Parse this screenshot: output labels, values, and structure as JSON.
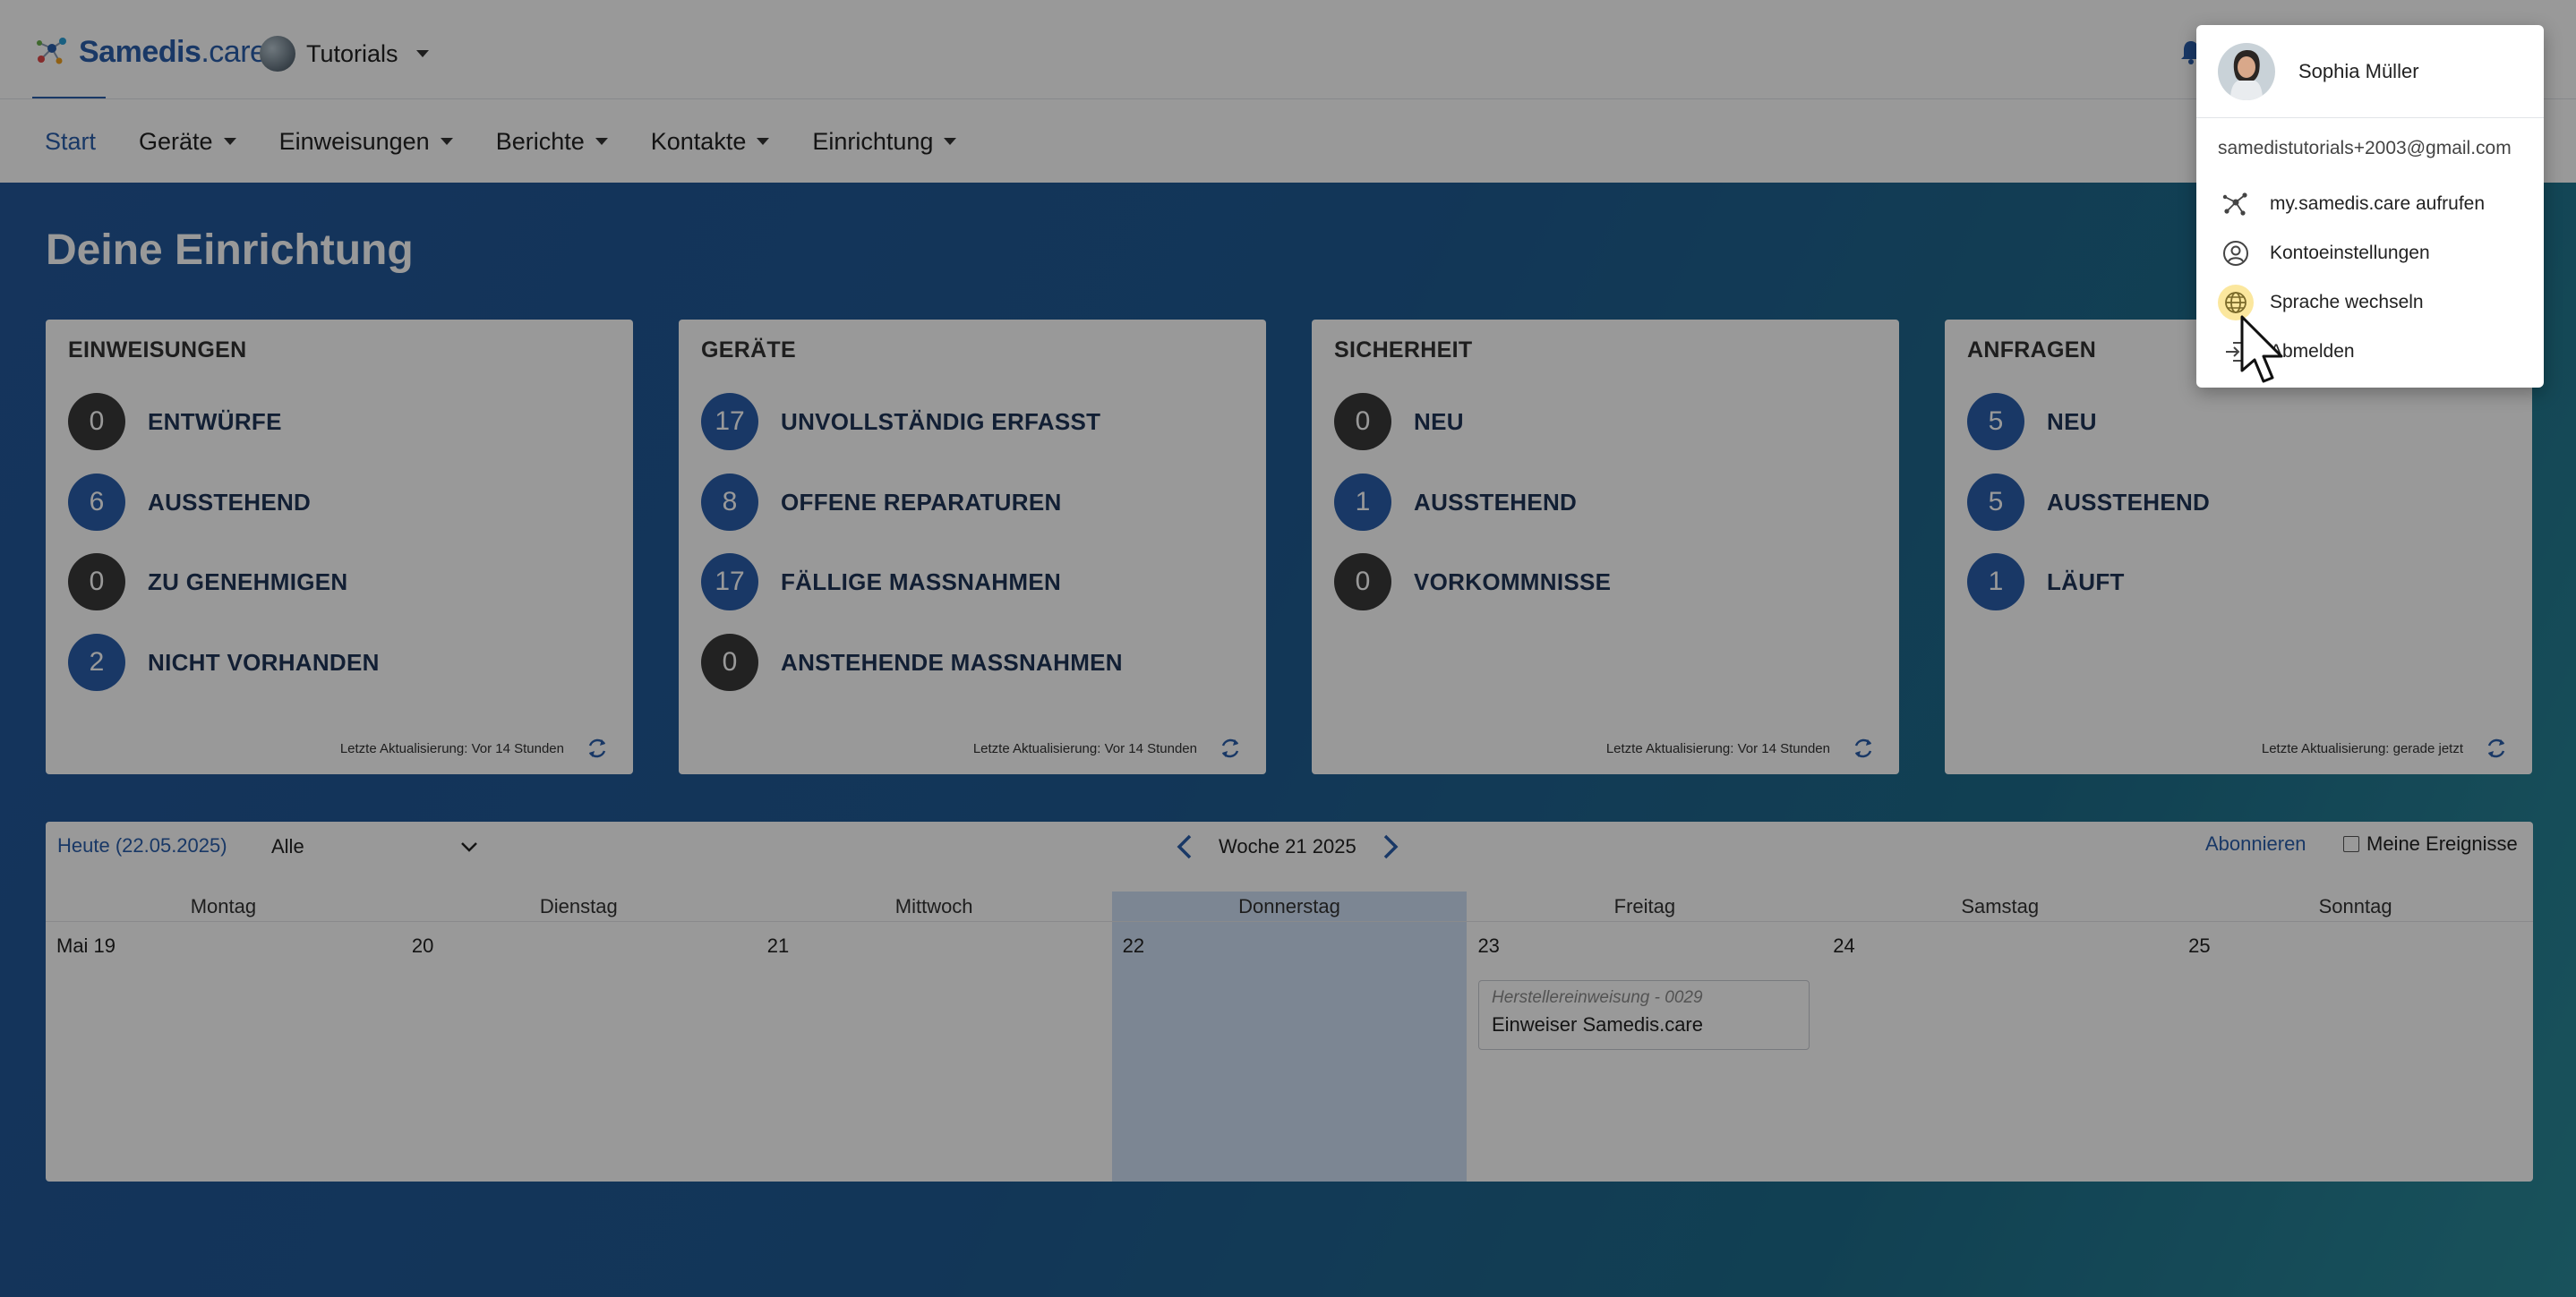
{
  "header": {
    "logo_brand": "Samedis",
    "logo_suffix": ".care",
    "tenant_label": "Tutorials"
  },
  "nav": {
    "items": [
      {
        "label": "Start",
        "active": true
      },
      {
        "label": "Geräte"
      },
      {
        "label": "Einweisungen"
      },
      {
        "label": "Berichte"
      },
      {
        "label": "Kontakte"
      },
      {
        "label": "Einrichtung"
      }
    ]
  },
  "main": {
    "title": "Deine Einrichtung"
  },
  "cards": [
    {
      "title": "EINWEISUNGEN",
      "rows": [
        {
          "count": "0",
          "label": "ENTWÜRFE",
          "style": "dark"
        },
        {
          "count": "6",
          "label": "AUSSTEHEND",
          "style": "blue"
        },
        {
          "count": "0",
          "label": "ZU GENEHMIGEN",
          "style": "dark"
        },
        {
          "count": "2",
          "label": "NICHT VORHANDEN",
          "style": "blue"
        }
      ],
      "footer": "Letzte Aktualisierung: Vor 14 Stunden"
    },
    {
      "title": "GERÄTE",
      "rows": [
        {
          "count": "17",
          "label": "UNVOLLSTÄNDIG ERFASST",
          "style": "blue"
        },
        {
          "count": "8",
          "label": "OFFENE REPARATUREN",
          "style": "blue"
        },
        {
          "count": "17",
          "label": "FÄLLIGE MASSNAHMEN",
          "style": "blue"
        },
        {
          "count": "0",
          "label": "ANSTEHENDE MASSNAHMEN",
          "style": "dark"
        }
      ],
      "footer": "Letzte Aktualisierung: Vor 14 Stunden"
    },
    {
      "title": "SICHERHEIT",
      "rows": [
        {
          "count": "0",
          "label": "NEU",
          "style": "dark"
        },
        {
          "count": "1",
          "label": "AUSSTEHEND",
          "style": "blue"
        },
        {
          "count": "0",
          "label": "VORKOMMNISSE",
          "style": "dark"
        }
      ],
      "footer": "Letzte Aktualisierung: Vor 14 Stunden"
    },
    {
      "title": "ANFRAGEN",
      "rows": [
        {
          "count": "5",
          "label": "NEU",
          "style": "blue"
        },
        {
          "count": "5",
          "label": "AUSSTEHEND",
          "style": "blue"
        },
        {
          "count": "1",
          "label": "LÄUFT",
          "style": "blue"
        }
      ],
      "footer": "Letzte Aktualisierung: gerade jetzt"
    }
  ],
  "calendar": {
    "today_label": "Heute (22.05.2025)",
    "filter_value": "Alle",
    "week_label": "Woche 21 2025",
    "subscribe_label": "Abonnieren",
    "my_events_label": "Meine Ereignisse",
    "day_headers": [
      "Montag",
      "Dienstag",
      "Mittwoch",
      "Donnerstag",
      "Freitag",
      "Samstag",
      "Sonntag"
    ],
    "day_numbers": [
      "Mai 19",
      "20",
      "21",
      "22",
      "23",
      "24",
      "25"
    ],
    "today_index": 3,
    "event": {
      "type": "Herstellereinweisung - 0029",
      "name": "Einweiser Samedis.care"
    }
  },
  "user_menu": {
    "name": "Sophia Müller",
    "email": "samedistutorials+2003@gmail.com",
    "items": [
      {
        "label": "my.samedis.care aufrufen",
        "icon": "network-icon"
      },
      {
        "label": "Kontoeinstellungen",
        "icon": "account-circle-icon"
      },
      {
        "label": "Sprache wechseln",
        "icon": "globe-icon",
        "highlighted": true
      },
      {
        "label": "Abmelden",
        "icon": "logout-icon"
      }
    ]
  },
  "colors": {
    "brand": "#2a5eaa",
    "badge_dark": "#3a3a3a",
    "highlight": "#fbe79e"
  }
}
